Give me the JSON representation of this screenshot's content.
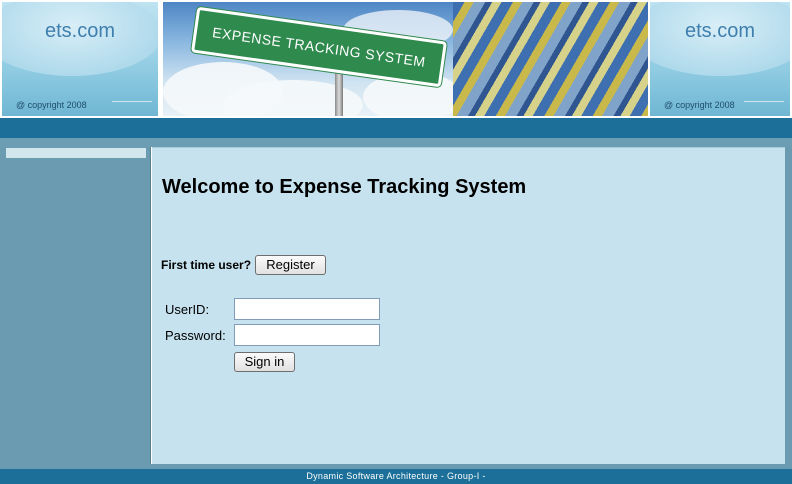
{
  "banner": {
    "brand_left": "ets.com",
    "copyright_left": "@ copyright 2008",
    "sign_text": "EXPENSE TRACKING SYSTEM",
    "brand_right": "ets.com",
    "copyright_right": "@ copyright 2008"
  },
  "main": {
    "welcome_title": "Welcome to Expense Tracking System",
    "first_time_label": "First time user?",
    "register_label": "Register",
    "userid_label": "UserID:",
    "password_label": "Password:",
    "userid_value": "",
    "password_value": "",
    "signin_label": "Sign in"
  },
  "footer": {
    "text": "Dynamic Software Architecture - Group-I -"
  },
  "colors": {
    "header_bar": "#1b6f98",
    "sidebar": "#6b9bb0",
    "content_bg": "#c5e2ee",
    "sign_green": "#2f8a4e"
  }
}
